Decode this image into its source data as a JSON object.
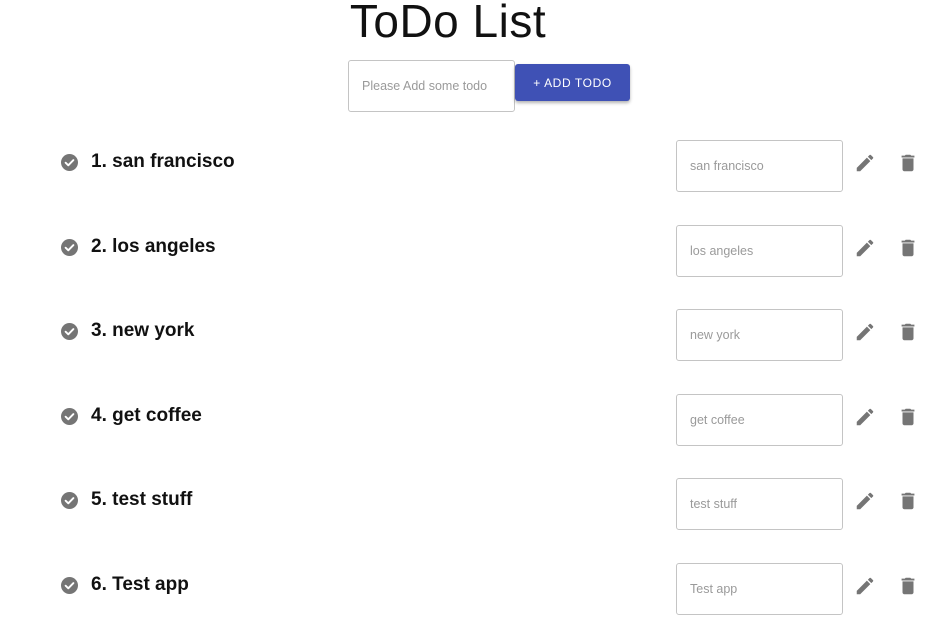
{
  "header": {
    "title": "ToDo List"
  },
  "add_form": {
    "placeholder": "Please Add some todo",
    "button_label": "+ ADD TODO"
  },
  "todos": [
    {
      "label": "1. san francisco",
      "edit_placeholder": "san francisco"
    },
    {
      "label": "2. los angeles",
      "edit_placeholder": "los angeles"
    },
    {
      "label": "3. new york",
      "edit_placeholder": "new york"
    },
    {
      "label": "4. get coffee",
      "edit_placeholder": "get coffee"
    },
    {
      "label": "5. test stuff",
      "edit_placeholder": "test stuff"
    },
    {
      "label": "6. Test app",
      "edit_placeholder": "Test app"
    }
  ],
  "icons": {
    "complete": "check-circle-icon",
    "edit": "pencil-icon",
    "delete": "trash-icon"
  },
  "colors": {
    "accent": "#3f51b5",
    "icon": "#757575"
  }
}
